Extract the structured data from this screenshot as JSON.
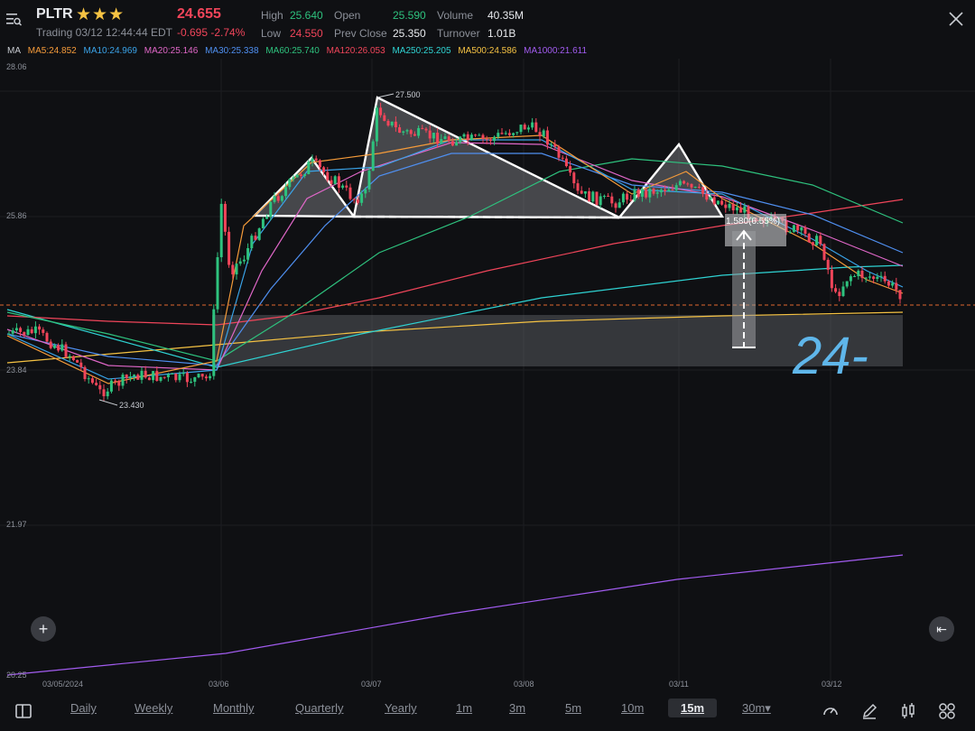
{
  "header": {
    "symbol": "PLTR",
    "stars": "★★★",
    "status": "Trading 03/12 12:44:44 EDT",
    "price": "24.655",
    "change": "-0.695 -2.74%",
    "high_label": "High",
    "high_value": "25.640",
    "low_label": "Low",
    "low_value": "24.550",
    "open_label": "Open",
    "open_value": "25.590",
    "prev_close_label": "Prev Close",
    "prev_close_value": "25.350",
    "volume_label": "Volume",
    "volume_value": "40.35M",
    "turnover_label": "Turnover",
    "turnover_value": "1.01B"
  },
  "ma_row": {
    "label": "MA",
    "items": [
      {
        "text": "MA5:24.852",
        "color": "#f59b3a"
      },
      {
        "text": "MA10:24.969",
        "color": "#3aa3e8"
      },
      {
        "text": "MA20:25.146",
        "color": "#e067c8"
      },
      {
        "text": "MA30:25.338",
        "color": "#4f8ff0"
      },
      {
        "text": "MA60:25.740",
        "color": "#2ec27e"
      },
      {
        "text": "MA120:26.053",
        "color": "#f0455a"
      },
      {
        "text": "MA250:25.205",
        "color": "#2fd3d3"
      },
      {
        "text": "MA500:24.586",
        "color": "#f5c243"
      },
      {
        "text": "MA1000:21.611",
        "color": "#a25cf0"
      }
    ]
  },
  "chart": {
    "y_labels": [
      "28.06",
      "25.86",
      "23.84",
      "21.97",
      "20.25"
    ],
    "x_labels": [
      "03/05/2024",
      "03/06",
      "03/07",
      "03/08",
      "03/11",
      "03/12"
    ],
    "peak_label": "27.500",
    "low_label": "23.430",
    "measure_label": "1.580(6.55%)",
    "handwriting": "24-"
  },
  "buttons": {
    "add": "+",
    "collapse": "⇤"
  },
  "timeframes": [
    {
      "label": "Daily",
      "active": false
    },
    {
      "label": "Weekly",
      "active": false
    },
    {
      "label": "Monthly",
      "active": false
    },
    {
      "label": "Quarterly",
      "active": false
    },
    {
      "label": "Yearly",
      "active": false
    },
    {
      "label": "1m",
      "active": false
    },
    {
      "label": "3m",
      "active": false
    },
    {
      "label": "5m",
      "active": false
    },
    {
      "label": "10m",
      "active": false
    },
    {
      "label": "15m",
      "active": true
    },
    {
      "label": "30m▾",
      "active": false
    }
  ]
}
